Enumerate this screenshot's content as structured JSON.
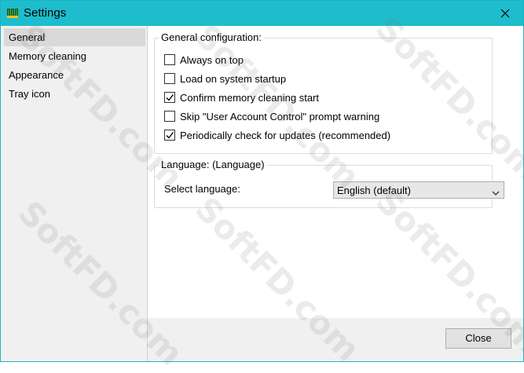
{
  "window": {
    "title": "Settings",
    "app_icon": "memory-cleaner-app-icon",
    "close_icon": "close-icon"
  },
  "sidebar": {
    "items": [
      {
        "label": "General",
        "selected": true
      },
      {
        "label": "Memory cleaning",
        "selected": false
      },
      {
        "label": "Appearance",
        "selected": false
      },
      {
        "label": "Tray icon",
        "selected": false
      }
    ]
  },
  "general": {
    "legend": "General configuration:",
    "options": [
      {
        "label": "Always on top",
        "checked": false
      },
      {
        "label": "Load on system startup",
        "checked": false
      },
      {
        "label": "Confirm memory cleaning start",
        "checked": true
      },
      {
        "label": "Skip \"User Account Control\" prompt warning",
        "checked": false
      },
      {
        "label": "Periodically check for updates (recommended)",
        "checked": true
      }
    ]
  },
  "language": {
    "legend": "Language: (Language)",
    "select_label": "Select language:",
    "selected_value": "English (default)"
  },
  "footer": {
    "close_label": "Close"
  },
  "colors": {
    "titlebar": "#1dbdcd",
    "selected_nav": "#d9d9d9",
    "panel": "#f0f0f0"
  },
  "watermark": "SoftFD.com"
}
